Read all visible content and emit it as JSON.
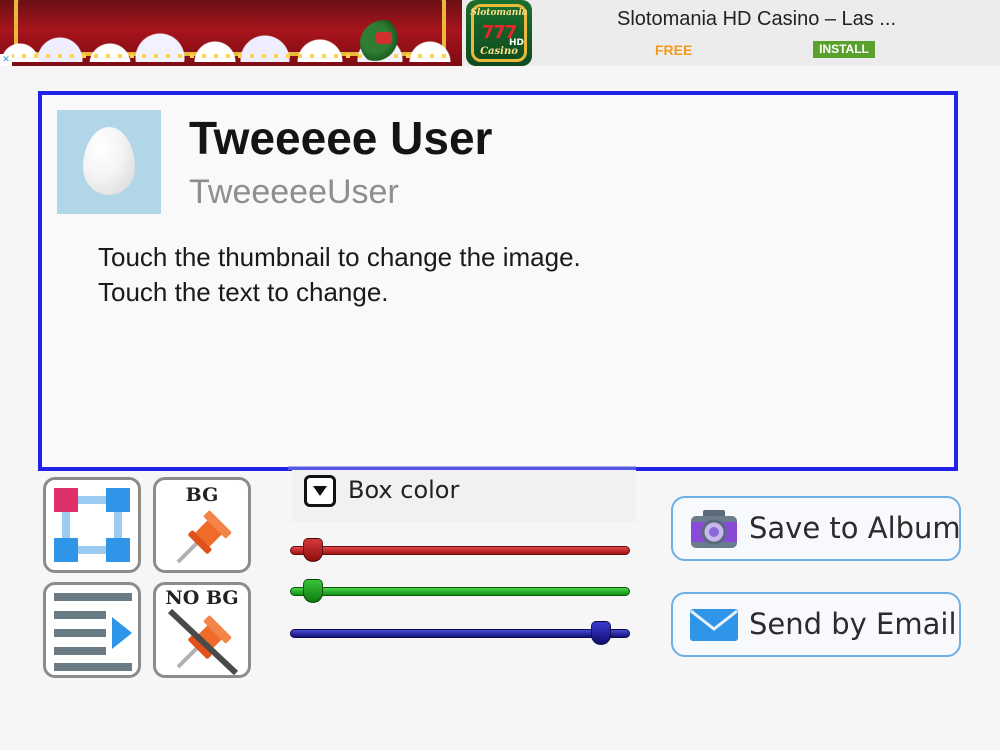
{
  "ad": {
    "title": "Slotomania HD Casino – Las ...",
    "free": "FREE",
    "install": "INSTALL",
    "close": "✕",
    "icon_brand": "Slotomania",
    "icon_sevens": "777",
    "icon_hd": "HD",
    "icon_casino": "Casino"
  },
  "card": {
    "display_name": "Tweeeee User",
    "handle": "TweeeeeUser",
    "tweet_lines": [
      "Touch the thumbnail to change the image.",
      "Touch the text to change."
    ],
    "border_color": "#2222e8"
  },
  "tools": {
    "bg_label": "BG",
    "no_bg_label": "NO BG"
  },
  "box_color": {
    "label": "Box color"
  },
  "sliders": {
    "red": 0.04,
    "green": 0.04,
    "blue": 0.94
  },
  "actions": {
    "save_label": "Save to Album",
    "email_label": "Send by Email"
  },
  "icons": [
    "frame-layout-icon",
    "pin-icon",
    "align-text-icon",
    "no-pin-icon",
    "camera-icon",
    "envelope-icon",
    "dropdown-icon"
  ]
}
